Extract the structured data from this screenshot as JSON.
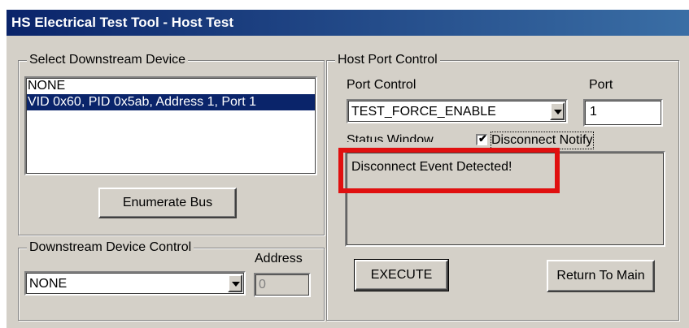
{
  "window": {
    "title": "HS Electrical Test Tool - Host Test"
  },
  "select_downstream": {
    "group_label": "Select Downstream Device",
    "items": [
      {
        "label": "NONE",
        "selected": false
      },
      {
        "label": "VID 0x60, PID 0x5ab, Address 1, Port 1",
        "selected": true
      }
    ],
    "enumerate_label": "Enumerate Bus"
  },
  "downstream_control": {
    "group_label": "Downstream Device Control",
    "address_label": "Address",
    "combo_value": "NONE",
    "address_value": "0"
  },
  "host_port": {
    "group_label": "Host Port Control",
    "port_control_label": "Port Control",
    "port_label": "Port",
    "port_control_value": "TEST_FORCE_ENABLE",
    "port_value": "1",
    "status_label": "Status Window",
    "disconnect_notify_label": "Disconnect Notify",
    "disconnect_notify_checked": true,
    "status_text": "Disconnect Event Detected!",
    "execute_label": "EXECUTE",
    "return_label": "Return To Main"
  },
  "colors": {
    "title_bar": "#0a246a",
    "highlight": "#e01010",
    "selection": "#0a246a"
  }
}
